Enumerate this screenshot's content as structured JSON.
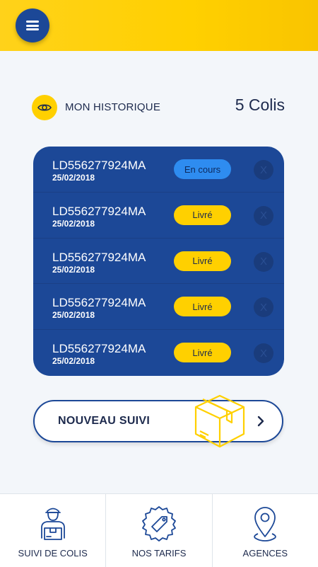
{
  "header": {
    "menu_icon": "hamburger-menu-icon"
  },
  "history": {
    "label": "MON HISTORIQUE",
    "count": "5 Colis",
    "icon": "eye-icon"
  },
  "parcels": [
    {
      "code": "LD556277924MA",
      "date": "25/02/2018",
      "status": "En cours"
    },
    {
      "code": "LD556277924MA",
      "date": "25/02/2018",
      "status": "Livré"
    },
    {
      "code": "LD556277924MA",
      "date": "25/02/2018",
      "status": "Livré"
    },
    {
      "code": "LD556277924MA",
      "date": "25/02/2018",
      "status": "Livré"
    },
    {
      "code": "LD556277924MA",
      "date": "25/02/2018",
      "status": "Livré"
    }
  ],
  "delete_label": "X",
  "new_tracking": {
    "label": "NOUVEAU SUIVI",
    "icon": "box-icon",
    "arrow": "chevron-right-icon"
  },
  "tabs": [
    {
      "label": "SUIVI DE COLIS",
      "icon": "delivery-man-icon"
    },
    {
      "label": "NOS TARIFS",
      "icon": "price-tag-icon"
    },
    {
      "label": "AGENCES",
      "icon": "map-pin-icon"
    }
  ],
  "colors": {
    "primary": "#1c4897",
    "accent": "#ffd000",
    "in_progress": "#2e8cf0"
  }
}
